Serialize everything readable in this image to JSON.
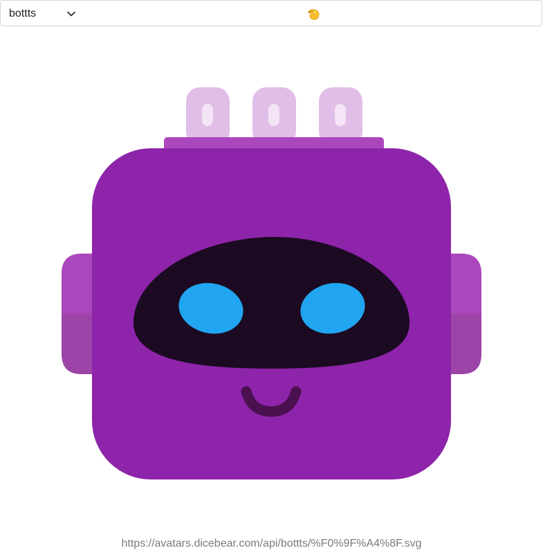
{
  "toolbar": {
    "style_select": {
      "selected": "bottts"
    },
    "seed_input": {
      "value_icon": "pinching-hand-emoji-icon"
    }
  },
  "avatar": {
    "style": "bottts",
    "colors": {
      "body": "#8E24AA",
      "antenna_bar": "#AB47BC",
      "antenna": "#E1BEE7",
      "antenna_highlight": "#F3E5F5",
      "side_top": "#AB47BC",
      "side_bottom": "#9C44A8",
      "visor": "#1B0A22",
      "eyes": "#22A5F1",
      "mouth": "#4A1050"
    }
  },
  "footer": {
    "url": "https://avatars.dicebear.com/api/bottts/%F0%9F%A4%8F.svg"
  }
}
